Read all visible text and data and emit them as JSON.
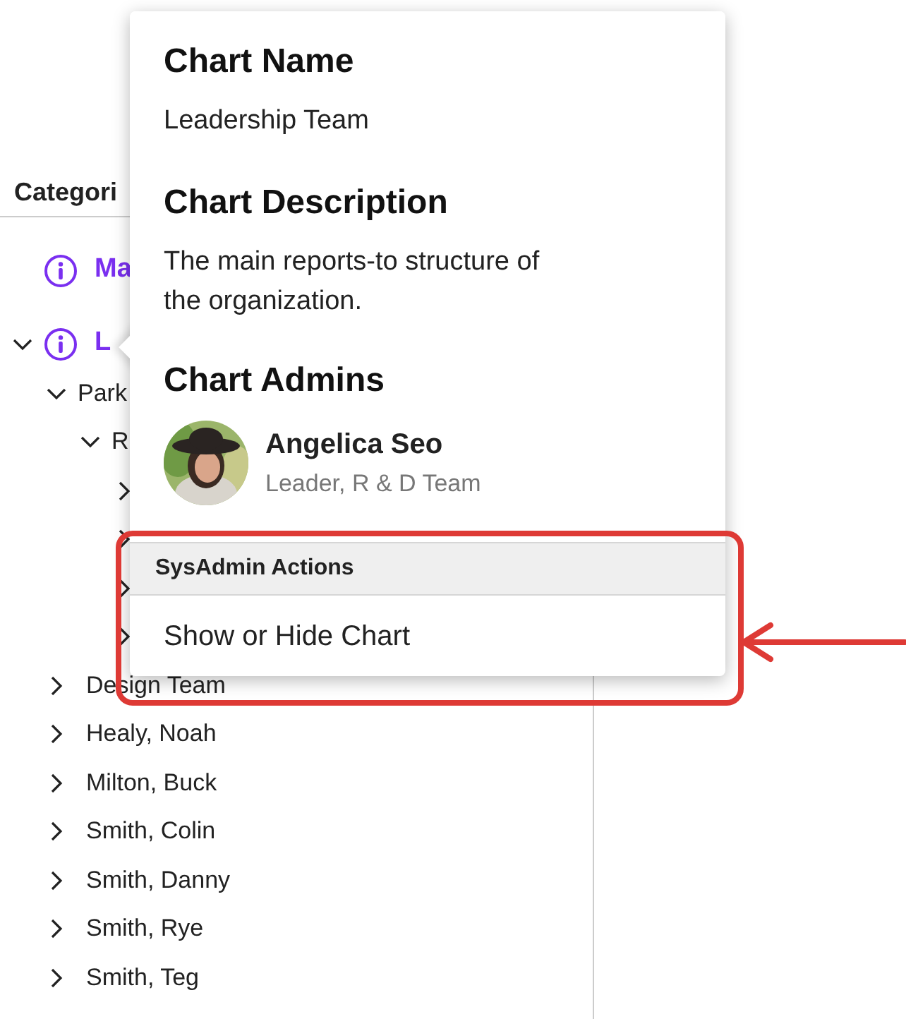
{
  "sidebar": {
    "header": "Categori",
    "tree": [
      {
        "label": "Ma",
        "kind": "info"
      },
      {
        "label": "L",
        "kind": "info",
        "expanded": true,
        "children": [
          {
            "label": "Park",
            "kind": "plain",
            "expanded": true,
            "children": [
              {
                "label": "R",
                "kind": "plain",
                "expanded": true,
                "children": [
                  {
                    "expanded": false
                  },
                  {
                    "expanded": false
                  },
                  {
                    "expanded": false
                  },
                  {
                    "expanded": false
                  }
                ]
              }
            ]
          },
          {
            "label": "Design Team",
            "kind": "plain",
            "expanded": false
          },
          {
            "label": "Healy, Noah",
            "kind": "plain",
            "expanded": false
          },
          {
            "label": "Milton, Buck",
            "kind": "plain",
            "expanded": false
          },
          {
            "label": "Smith, Colin",
            "kind": "plain",
            "expanded": false
          },
          {
            "label": "Smith, Danny",
            "kind": "plain",
            "expanded": false
          },
          {
            "label": "Smith, Rye",
            "kind": "plain",
            "expanded": false
          },
          {
            "label": "Smith, Teg",
            "kind": "plain",
            "expanded": false
          }
        ]
      }
    ]
  },
  "popup": {
    "name_heading": "Chart Name",
    "name": "Leadership Team",
    "description_heading": "Chart Description",
    "description": "The main reports-to structure of the organization.",
    "admins_heading": "Chart Admins",
    "admins": [
      {
        "name": "Angelica Seo",
        "role": "Leader, R & D Team"
      }
    ],
    "actions": {
      "heading": "SysAdmin Actions",
      "items": [
        "Show or Hide Chart"
      ]
    }
  }
}
